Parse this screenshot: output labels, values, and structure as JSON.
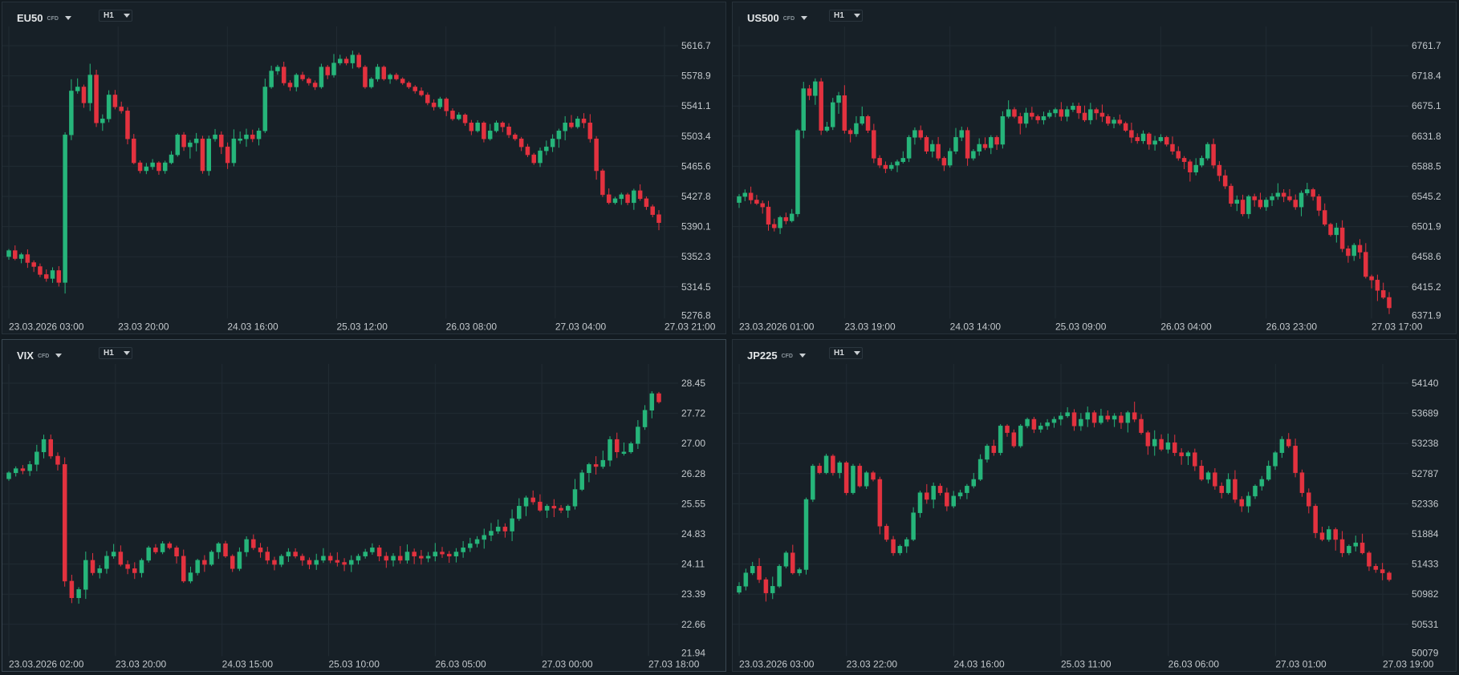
{
  "panels": [
    {
      "symbol": "EU50",
      "tag": "CFD",
      "timeframe": "H1"
    },
    {
      "symbol": "US500",
      "tag": "CFD",
      "timeframe": "H1"
    },
    {
      "symbol": "VIX",
      "tag": "CFD",
      "timeframe": "H1"
    },
    {
      "symbol": "JP225",
      "tag": "CFD",
      "timeframe": "H1"
    }
  ],
  "colors": {
    "up": "#26b57a",
    "down": "#e3323f",
    "grid": "#212b33",
    "text": "#c3c8cc"
  },
  "chart_data": [
    {
      "type": "candlestick",
      "title": "EU50",
      "yticks": [
        "5616.7",
        "5578.9",
        "5541.1",
        "5503.4",
        "5465.6",
        "5427.8",
        "5390.1",
        "5352.3",
        "5314.5",
        "5276.8"
      ],
      "ylim": [
        5276.8,
        5616.7
      ],
      "xticks": [
        "23.03.2026 03:00",
        "23.03 20:00",
        "24.03 16:00",
        "25.03 12:00",
        "26.03 08:00",
        "27.03 04:00",
        "27.03 21:00"
      ],
      "closes": [
        5360,
        5350,
        5355,
        5345,
        5340,
        5330,
        5325,
        5335,
        5320,
        5505,
        5560,
        5565,
        5545,
        5580,
        5520,
        5525,
        5555,
        5540,
        5535,
        5500,
        5470,
        5460,
        5465,
        5470,
        5460,
        5470,
        5480,
        5505,
        5490,
        5495,
        5500,
        5460,
        5500,
        5505,
        5490,
        5470,
        5500,
        5500,
        5505,
        5500,
        5510,
        5565,
        5585,
        5590,
        5570,
        5565,
        5580,
        5575,
        5570,
        5565,
        5590,
        5580,
        5595,
        5600,
        5595,
        5605,
        5590,
        5565,
        5575,
        5590,
        5575,
        5580,
        5575,
        5570,
        5565,
        5560,
        5555,
        5545,
        5540,
        5550,
        5535,
        5525,
        5530,
        5520,
        5510,
        5520,
        5500,
        5510,
        5520,
        5515,
        5505,
        5500,
        5490,
        5480,
        5470,
        5485,
        5490,
        5500,
        5510,
        5520,
        5515,
        5525,
        5520,
        5500,
        5460,
        5430,
        5420,
        5425,
        5430,
        5420,
        5435,
        5425,
        5415,
        5405,
        5395
      ]
    },
    {
      "type": "candlestick",
      "title": "US500",
      "yticks": [
        "6761.7",
        "6718.4",
        "6675.1",
        "6631.8",
        "6588.5",
        "6545.2",
        "6501.9",
        "6458.6",
        "6415.2",
        "6371.9"
      ],
      "ylim": [
        6371.9,
        6761.7
      ],
      "xticks": [
        "23.03.2026 01:00",
        "23.03 19:00",
        "24.03 14:00",
        "25.03 09:00",
        "26.03 04:00",
        "26.03 23:00",
        "27.03 17:00"
      ],
      "closes": [
        6545,
        6550,
        6540,
        6535,
        6530,
        6505,
        6500,
        6515,
        6510,
        6520,
        6640,
        6700,
        6690,
        6710,
        6640,
        6645,
        6680,
        6690,
        6640,
        6635,
        6650,
        6660,
        6640,
        6600,
        6590,
        6585,
        6590,
        6595,
        6600,
        6630,
        6640,
        6630,
        6610,
        6620,
        6600,
        6590,
        6610,
        6630,
        6640,
        6600,
        6610,
        6620,
        6615,
        6630,
        6620,
        6660,
        6670,
        6660,
        6650,
        6665,
        6660,
        6655,
        6660,
        6665,
        6670,
        6660,
        6670,
        6675,
        6665,
        6655,
        6670,
        6665,
        6660,
        6650,
        6655,
        6650,
        6640,
        6630,
        6625,
        6635,
        6620,
        6625,
        6630,
        6620,
        6610,
        6600,
        6595,
        6580,
        6590,
        6600,
        6620,
        6590,
        6575,
        6560,
        6535,
        6540,
        6520,
        6545,
        6540,
        6530,
        6540,
        6545,
        6550,
        6545,
        6540,
        6530,
        6550,
        6555,
        6545,
        6525,
        6505,
        6490,
        6500,
        6470,
        6460,
        6475,
        6465,
        6430,
        6425,
        6410,
        6400,
        6385
      ]
    },
    {
      "type": "candlestick",
      "title": "VIX",
      "yticks": [
        "28.45",
        "27.72",
        "27.00",
        "26.28",
        "25.55",
        "24.83",
        "24.11",
        "23.39",
        "22.66",
        "21.94"
      ],
      "ylim": [
        21.94,
        28.45
      ],
      "xticks": [
        "23.03.2026 02:00",
        "23.03 20:00",
        "24.03 15:00",
        "25.03 10:00",
        "26.03 05:00",
        "27.03 00:00",
        "27.03 18:00"
      ],
      "closes": [
        26.3,
        26.4,
        26.35,
        26.5,
        26.8,
        27.1,
        26.7,
        26.5,
        23.7,
        23.3,
        23.5,
        24.2,
        23.9,
        24.0,
        24.3,
        24.4,
        24.1,
        24.0,
        23.9,
        24.2,
        24.5,
        24.4,
        24.6,
        24.5,
        24.3,
        23.7,
        23.9,
        24.2,
        24.1,
        24.4,
        24.6,
        24.3,
        24.0,
        24.4,
        24.7,
        24.5,
        24.4,
        24.2,
        24.1,
        24.3,
        24.4,
        24.3,
        24.2,
        24.1,
        24.2,
        24.3,
        24.2,
        24.15,
        24.1,
        24.2,
        24.3,
        24.4,
        24.5,
        24.3,
        24.2,
        24.3,
        24.2,
        24.4,
        24.3,
        24.25,
        24.3,
        24.4,
        24.35,
        24.3,
        24.4,
        24.5,
        24.6,
        24.7,
        24.8,
        24.9,
        25.0,
        24.9,
        25.2,
        25.5,
        25.7,
        25.6,
        25.4,
        25.5,
        25.45,
        25.4,
        25.5,
        25.9,
        26.3,
        26.5,
        26.45,
        26.6,
        27.1,
        26.8,
        26.8,
        27.0,
        27.4,
        27.8,
        28.2,
        28.0
      ]
    },
    {
      "type": "candlestick",
      "title": "JP225",
      "yticks": [
        "54140",
        "53689",
        "53238",
        "52787",
        "52336",
        "51884",
        "51433",
        "50982",
        "50531",
        "50079"
      ],
      "ylim": [
        50079,
        54140
      ],
      "xticks": [
        "23.03.2026 03:00",
        "23.03 22:00",
        "24.03 16:00",
        "25.03 11:00",
        "26.03 06:00",
        "27.03 01:00",
        "27.03 19:00"
      ],
      "closes": [
        51100,
        51300,
        51400,
        51200,
        51000,
        51100,
        51400,
        51600,
        51300,
        51350,
        52400,
        52900,
        52800,
        53050,
        52800,
        52950,
        52500,
        52900,
        52600,
        52800,
        52700,
        52000,
        51800,
        51600,
        51700,
        51800,
        52200,
        52500,
        52400,
        52600,
        52500,
        52300,
        52450,
        52500,
        52600,
        52700,
        53000,
        53200,
        53100,
        53500,
        53400,
        53200,
        53500,
        53600,
        53450,
        53500,
        53550,
        53600,
        53650,
        53700,
        53500,
        53600,
        53700,
        53550,
        53650,
        53600,
        53650,
        53550,
        53700,
        53600,
        53400,
        53200,
        53300,
        53150,
        53250,
        53100,
        53050,
        53100,
        52900,
        52700,
        52800,
        52600,
        52500,
        52700,
        52400,
        52300,
        52450,
        52600,
        52700,
        52900,
        53100,
        53300,
        53200,
        52800,
        52500,
        52300,
        51900,
        51800,
        51950,
        51800,
        51600,
        51700,
        51750,
        51600,
        51400,
        51350,
        51300,
        51200
      ]
    }
  ]
}
